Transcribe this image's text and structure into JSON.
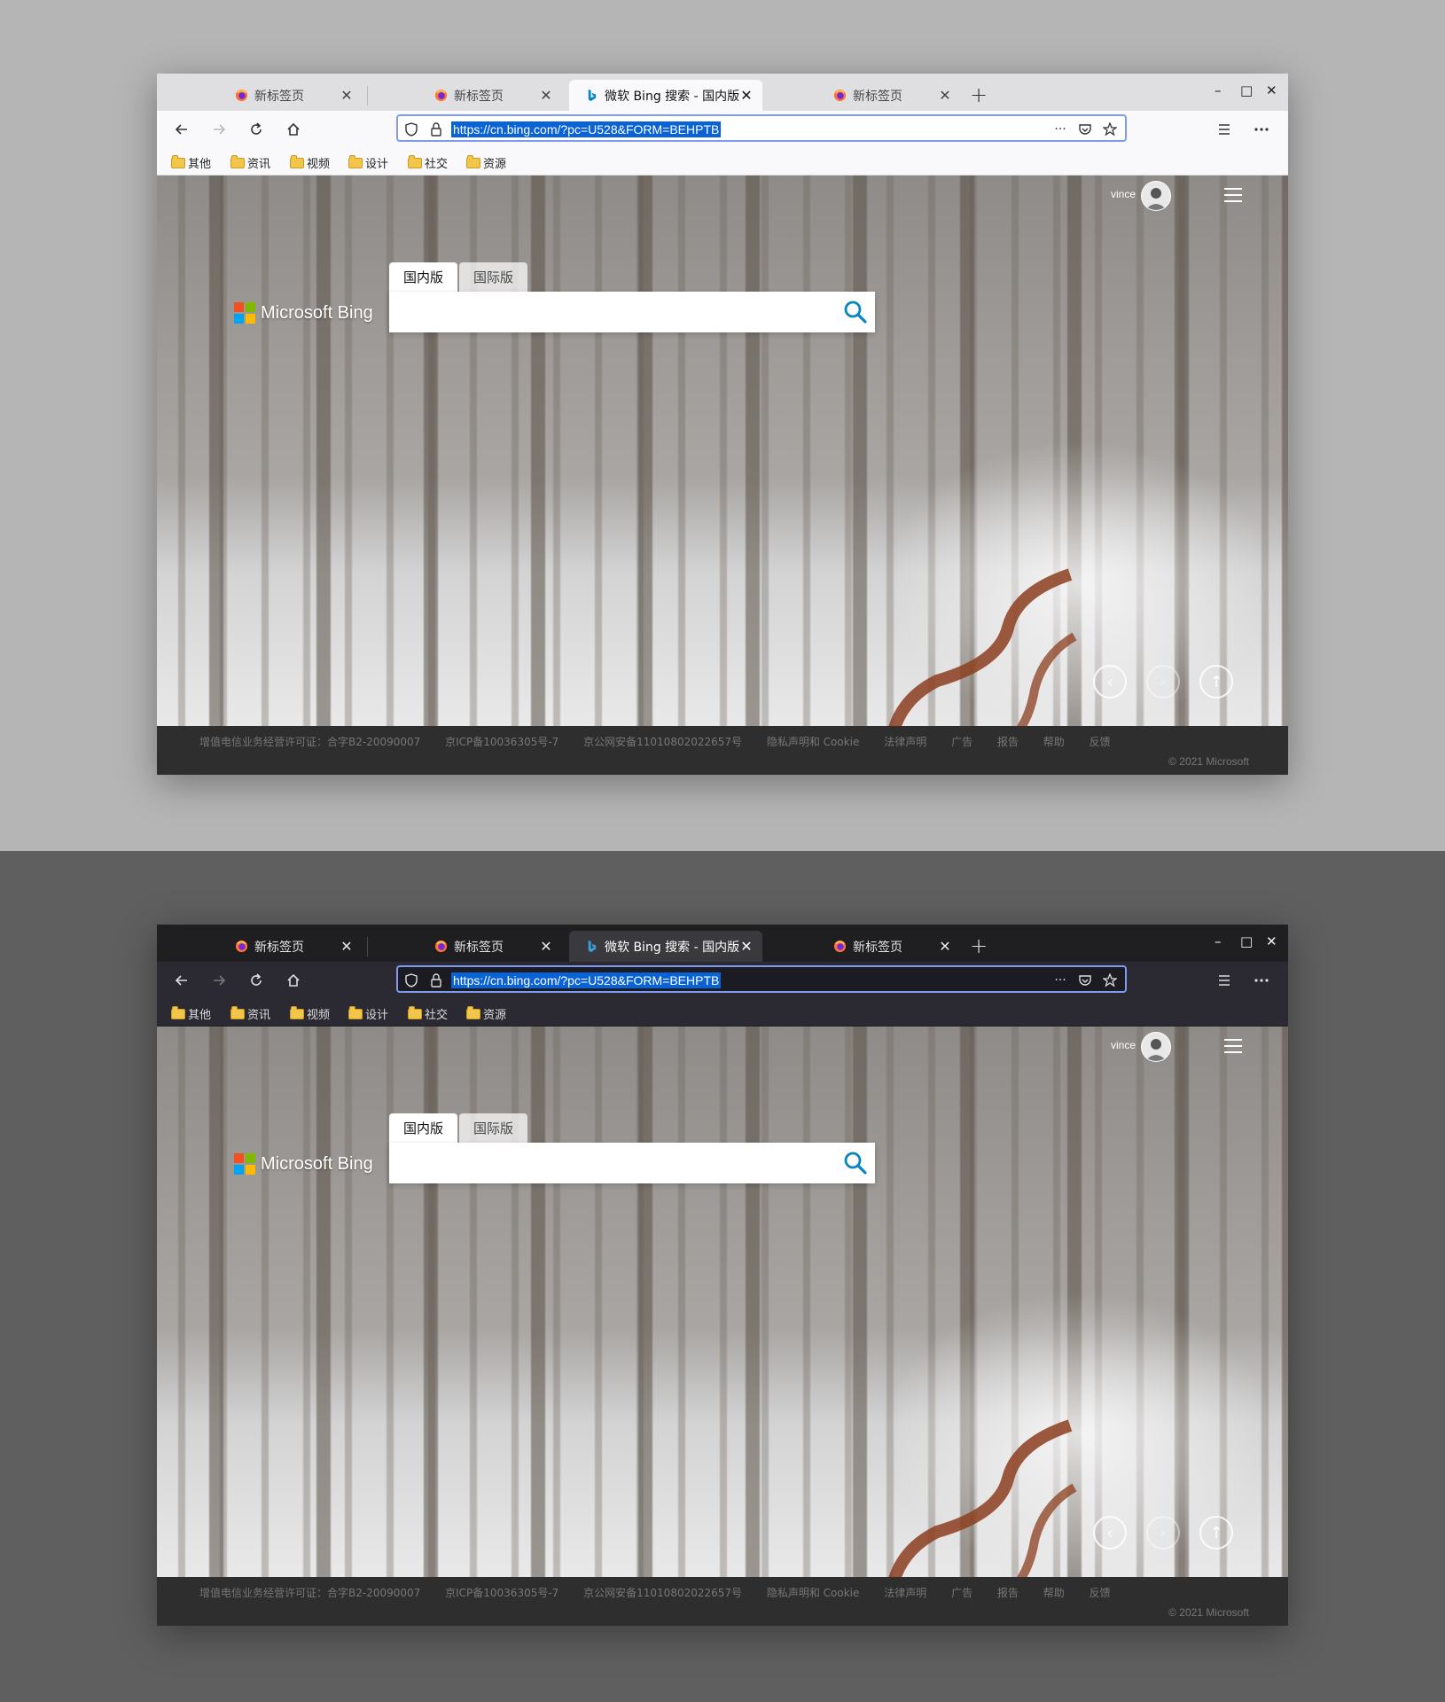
{
  "tabs": [
    {
      "label": "新标签页",
      "icon": "firefox-icon"
    },
    {
      "label": "新标签页",
      "icon": "firefox-icon"
    },
    {
      "label": "微软 Bing 搜索 - 国内版",
      "icon": "bing-icon",
      "active": true
    },
    {
      "label": "新标签页",
      "icon": "firefox-icon"
    }
  ],
  "tab_close": "✕",
  "new_tab": "+",
  "window_controls": {
    "minimize": "–",
    "maximize": "□",
    "close": "✕"
  },
  "url": "https://cn.bing.com/?pc=U528&FORM=BEHPTB",
  "url_more": "···",
  "bookmarks": [
    "其他",
    "资讯",
    "视频",
    "设计",
    "社交",
    "资源"
  ],
  "user": {
    "name": "vince"
  },
  "logo": "Microsoft Bing",
  "search_tabs": [
    "国内版",
    "国际版"
  ],
  "footer": {
    "links": [
      "增值电信业务经营许可证：合字B2-20090007",
      "京ICP备10036305号-7",
      "京公网安备11010802022657号",
      "隐私声明和 Cookie",
      "法律声明",
      "广告",
      "报告",
      "帮助",
      "反馈"
    ],
    "copyright": "© 2021 Microsoft"
  },
  "carousel": {
    "prev": "‹",
    "next": "›",
    "info": "↑"
  },
  "colors": {
    "accent_url_bg": "#0a63d6",
    "ms_red": "#f25022",
    "ms_green": "#7fba00",
    "ms_blue": "#00a4ef",
    "ms_yellow": "#ffb900",
    "bing_blue": "#0a84c4",
    "trail": "#8b3e1e"
  }
}
